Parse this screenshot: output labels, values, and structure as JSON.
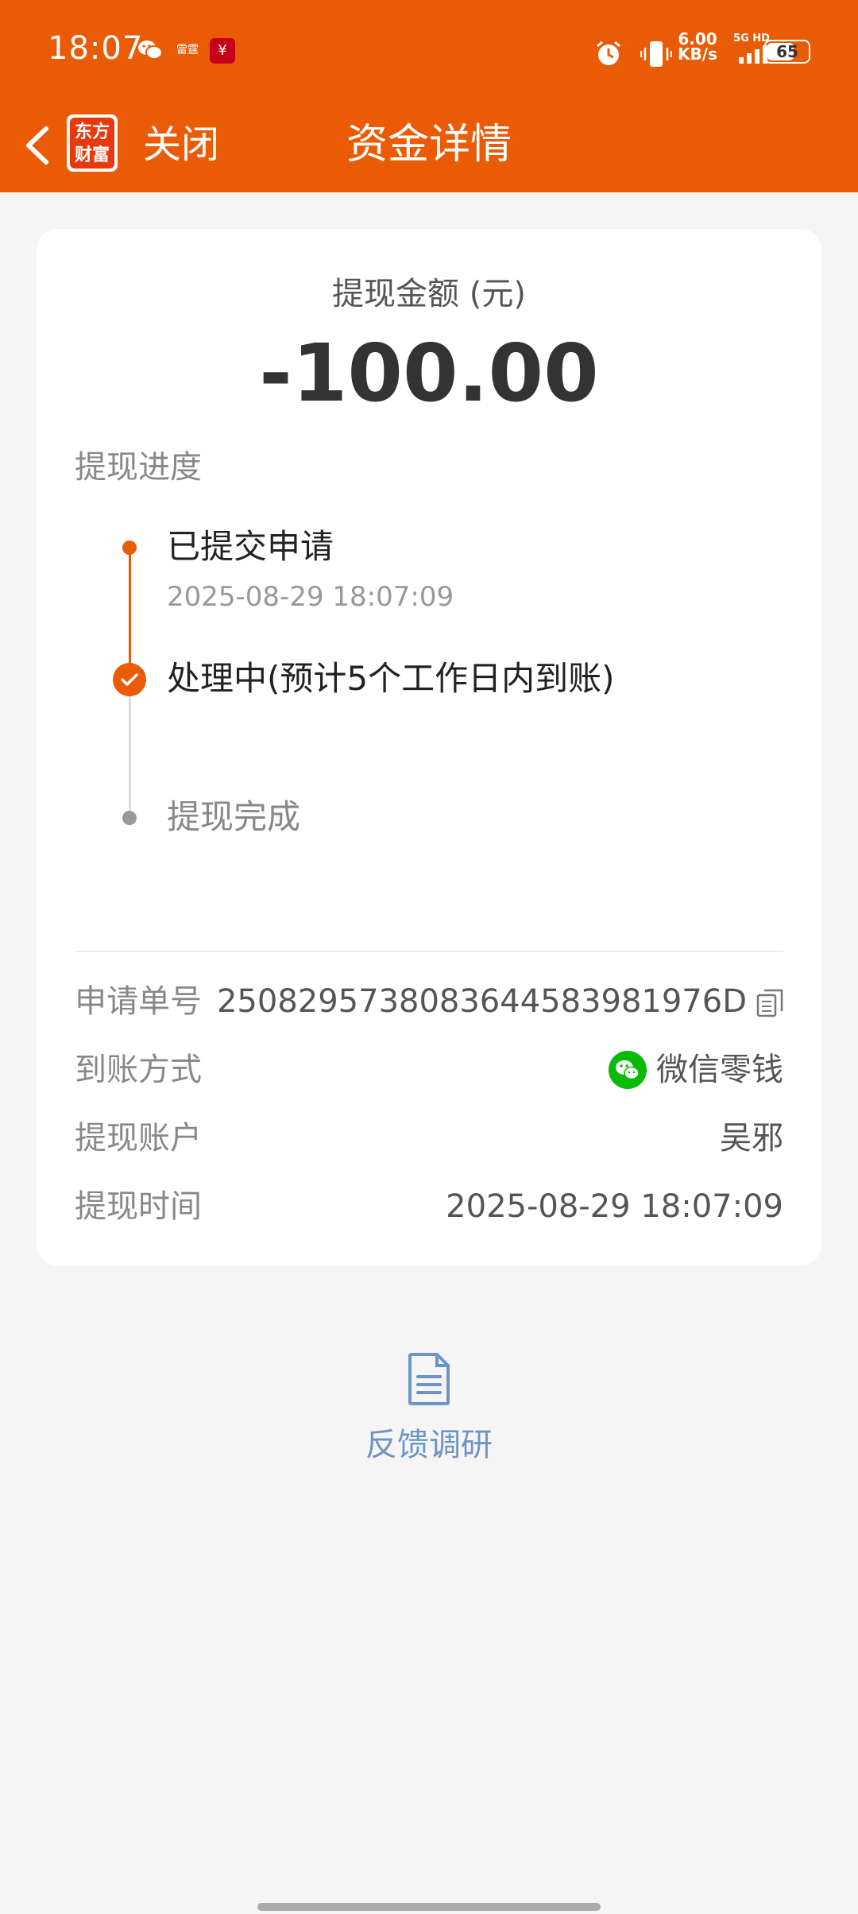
{
  "status_bar": {
    "time": "18:07",
    "app_label": "雷霆",
    "net_speed_value": "6.00",
    "net_speed_unit": "KB/s",
    "signal_label": "5G HD",
    "battery": "65",
    "battery_level": 0.65
  },
  "nav": {
    "logo_line1": "东方",
    "logo_line2": "财富",
    "close_label": "关闭",
    "title": "资金详情"
  },
  "summary": {
    "amount_label": "提现金额 (元)",
    "amount": "-100.00"
  },
  "progress": {
    "title": "提现进度",
    "steps": [
      {
        "label": "已提交申请",
        "time": "2025-08-29 18:07:09"
      },
      {
        "label": "处理中(预计5个工作日内到账)"
      },
      {
        "label": "提现完成"
      }
    ]
  },
  "details": [
    {
      "label": "申请单号",
      "value": "2508295738083644583981976D"
    },
    {
      "label": "到账方式",
      "value": "微信零钱"
    },
    {
      "label": "提现账户",
      "value": "吴邪"
    },
    {
      "label": "提现时间",
      "value": "2025-08-29 18:07:09"
    }
  ],
  "feedback": {
    "label": "反馈调研"
  },
  "colors": {
    "brand": "#ea5b06",
    "wechat": "#09bb07",
    "link": "#6c95c6"
  }
}
